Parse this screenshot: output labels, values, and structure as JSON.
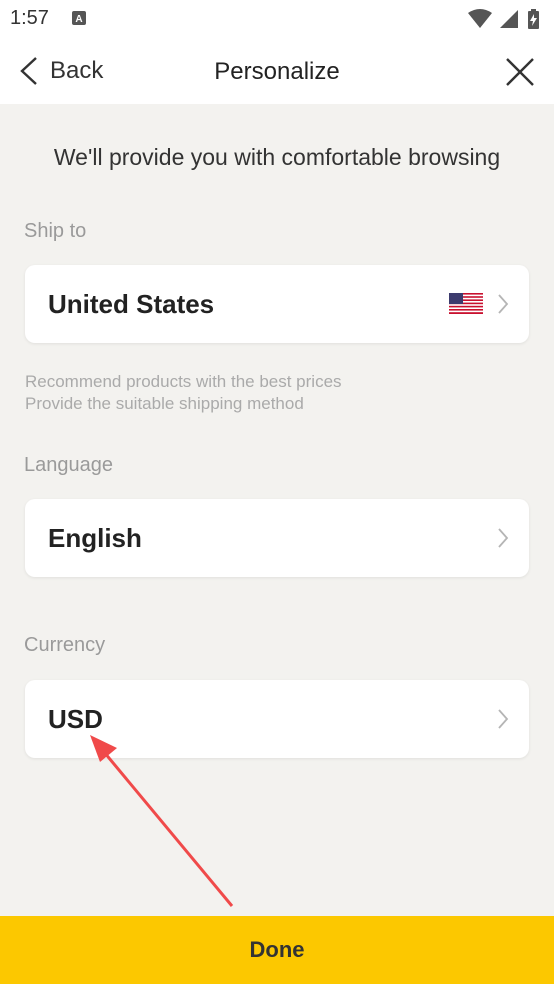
{
  "status_bar": {
    "time": "1:57",
    "notification_icon": "a-letter-icon",
    "icons": [
      "wifi-icon",
      "signal-icon",
      "battery-charging-icon"
    ]
  },
  "nav": {
    "back_label": "Back",
    "title": "Personalize",
    "close_icon": "close-icon"
  },
  "intro": "We'll provide you with comfortable browsing",
  "ship_to": {
    "label": "Ship to",
    "value": "United States",
    "flag_icon": "us-flag-icon",
    "hint_lines": [
      "Recommend products with the best prices",
      "Provide the suitable shipping method"
    ]
  },
  "language": {
    "label": "Language",
    "value": "English"
  },
  "currency": {
    "label": "Currency",
    "value": "USD"
  },
  "done_label": "Done",
  "colors": {
    "accent": "#fcc800",
    "background": "#f3f2ef",
    "annotation_arrow": "#f04a4a"
  }
}
